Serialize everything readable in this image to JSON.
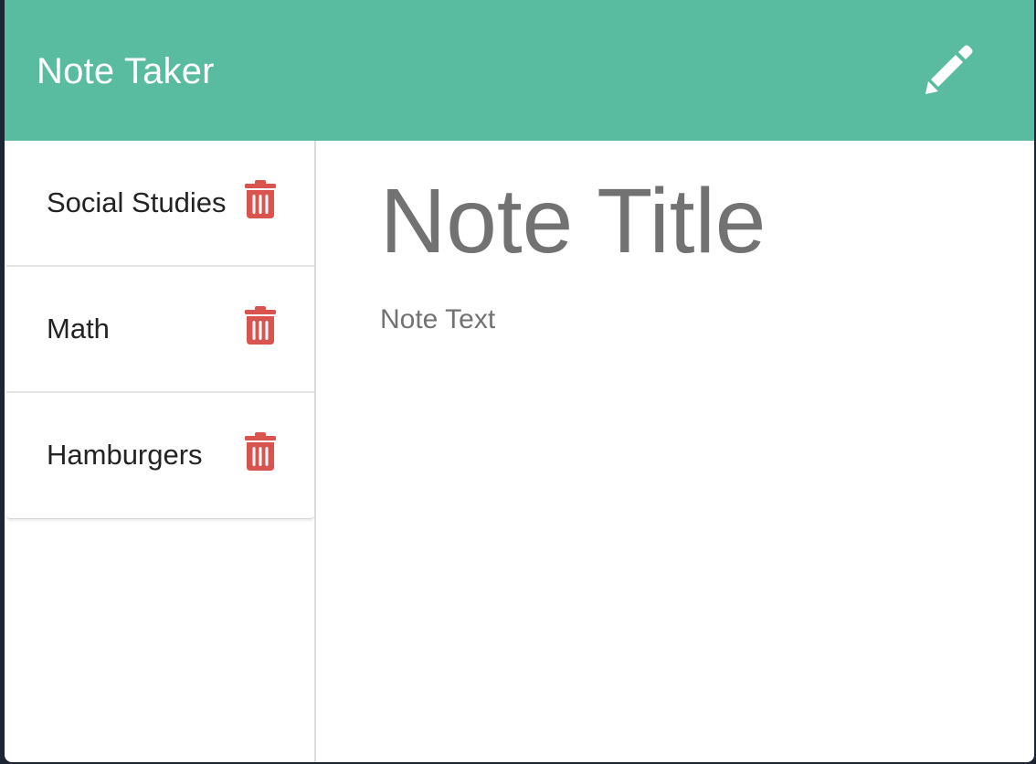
{
  "app": {
    "brand": "Note Taker",
    "accent_color": "#59bb9f",
    "danger_color": "#d9534f"
  },
  "navbar": {
    "new_note_icon": "pencil-icon"
  },
  "notes": [
    {
      "title": "Social Studies",
      "delete_icon": "trash-icon"
    },
    {
      "title": "Math",
      "delete_icon": "trash-icon"
    },
    {
      "title": "Hamburgers",
      "delete_icon": "trash-icon"
    }
  ],
  "editor": {
    "title_placeholder": "Note Title",
    "text_placeholder": "Note Text"
  }
}
